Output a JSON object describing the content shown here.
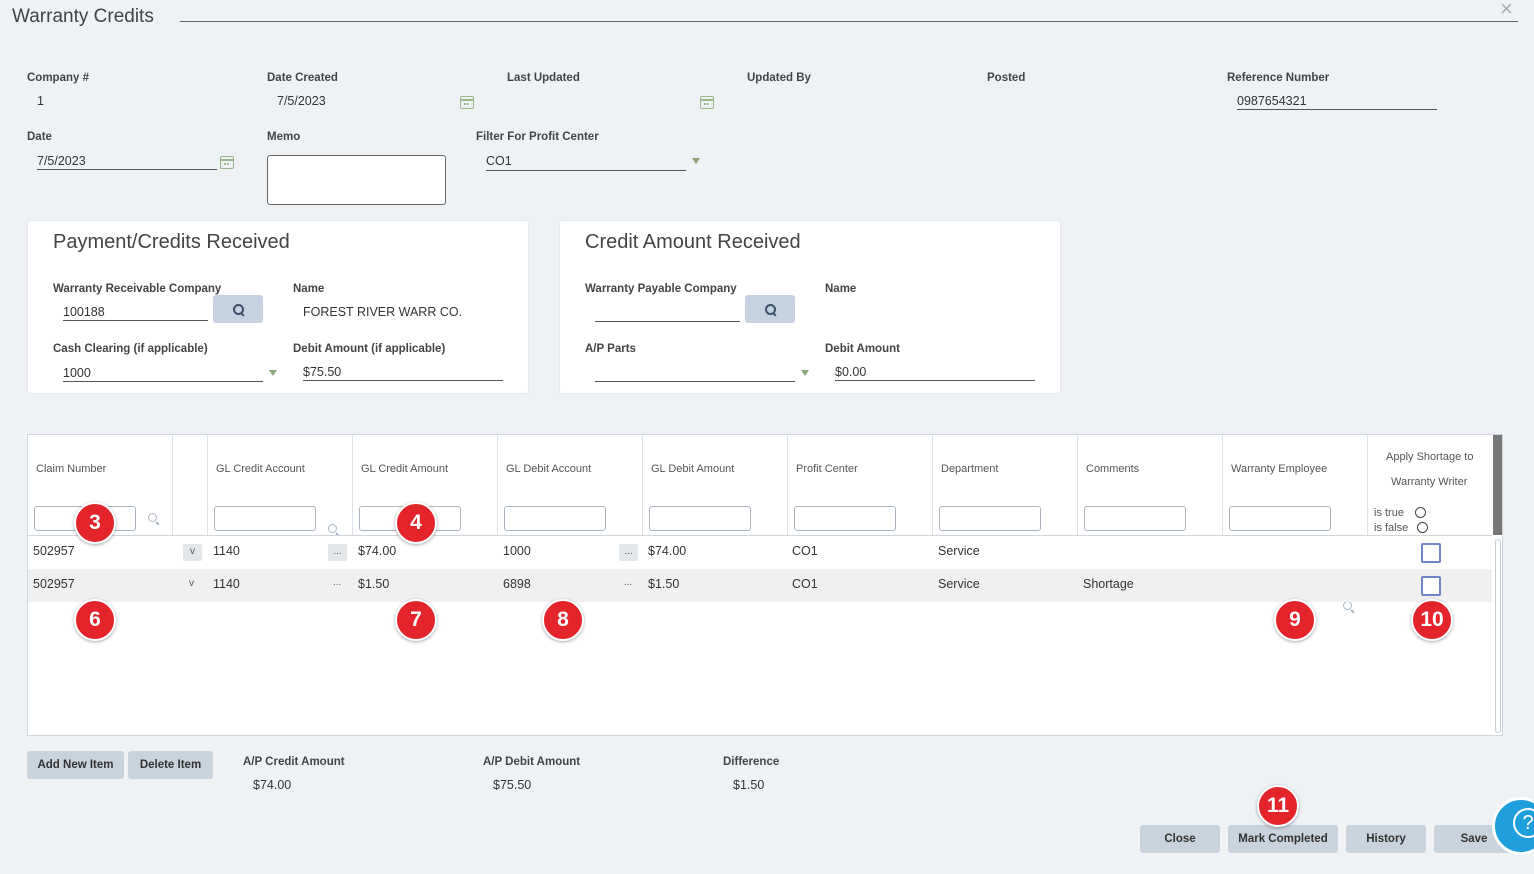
{
  "window": {
    "title": "Warranty Credits",
    "close_icon": "×"
  },
  "header": {
    "company_label": "Company #",
    "company_value": "1",
    "date_created_label": "Date Created",
    "date_created_value": "7/5/2023",
    "last_updated_label": "Last Updated",
    "last_updated_value": "",
    "updated_by_label": "Updated By",
    "posted_label": "Posted",
    "reference_label": "Reference Number",
    "reference_value": "0987654321",
    "date_label": "Date",
    "date_value": "7/5/2023",
    "memo_label": "Memo",
    "memo_value": "",
    "filter_label": "Filter For Profit Center",
    "filter_value": "CO1"
  },
  "payment_panel": {
    "title": "Payment/Credits Received",
    "receivable_company_label": "Warranty Receivable Company",
    "receivable_company_value": "100188",
    "name_label": "Name",
    "name_value": "FOREST RIVER WARR CO.",
    "cash_clearing_label": "Cash Clearing (if applicable)",
    "cash_clearing_value": "1000",
    "debit_amount_label": "Debit Amount (if applicable)",
    "debit_amount_value": "$75.50"
  },
  "credit_panel": {
    "title": "Credit Amount Received",
    "payable_company_label": "Warranty Payable Company",
    "payable_company_value": "",
    "name_label": "Name",
    "name_value": "",
    "ap_parts_label": "A/P Parts",
    "ap_parts_value": "",
    "debit_amount_label": "Debit Amount",
    "debit_amount_value": "$0.00"
  },
  "grid": {
    "columns": [
      "Claim Number",
      "GL Credit Account",
      "GL Credit Amount",
      "GL Debit Account",
      "GL Debit Amount",
      "Profit Center",
      "Department",
      "Comments",
      "Warranty Employee"
    ],
    "apply_shortage_line1": "Apply Shortage to",
    "apply_shortage_line2": "Warranty Writer",
    "is_true_label": "is true",
    "is_false_label": "is false",
    "row_menu_glyph": "v",
    "row_lookup_glyph": "...",
    "rows": [
      {
        "claim": "502957",
        "gl_credit_account": "1140",
        "gl_credit_amount": "$74.00",
        "gl_debit_account": "1000",
        "gl_debit_amount": "$74.00",
        "profit_center": "CO1",
        "department": "Service",
        "comments": "",
        "employee": "",
        "apply_shortage": false
      },
      {
        "claim": "502957",
        "gl_credit_account": "1140",
        "gl_credit_amount": "$1.50",
        "gl_debit_account": "6898",
        "gl_debit_amount": "$1.50",
        "profit_center": "CO1",
        "department": "Service",
        "comments": "Shortage",
        "employee": "",
        "apply_shortage": false
      }
    ]
  },
  "footer": {
    "add_item_label": "Add New Item",
    "delete_item_label": "Delete Item",
    "ap_credit_label": "A/P Credit Amount",
    "ap_credit_value": "$74.00",
    "ap_debit_label": "A/P Debit Amount",
    "ap_debit_value": "$75.50",
    "difference_label": "Difference",
    "difference_value": "$1.50",
    "close_label": "Close",
    "mark_completed_label": "Mark Completed",
    "history_label": "History",
    "save_label": "Save",
    "help_glyph": "?"
  },
  "badges": {
    "b3": "3",
    "b4": "4",
    "b6": "6",
    "b7": "7",
    "b8": "8",
    "b9": "9",
    "b10": "10",
    "b11": "11"
  },
  "colors": {
    "badge": "#e3242b",
    "button": "#c9d3dd",
    "help": "#1fa0dc",
    "checkbox": "#6d86c4"
  }
}
